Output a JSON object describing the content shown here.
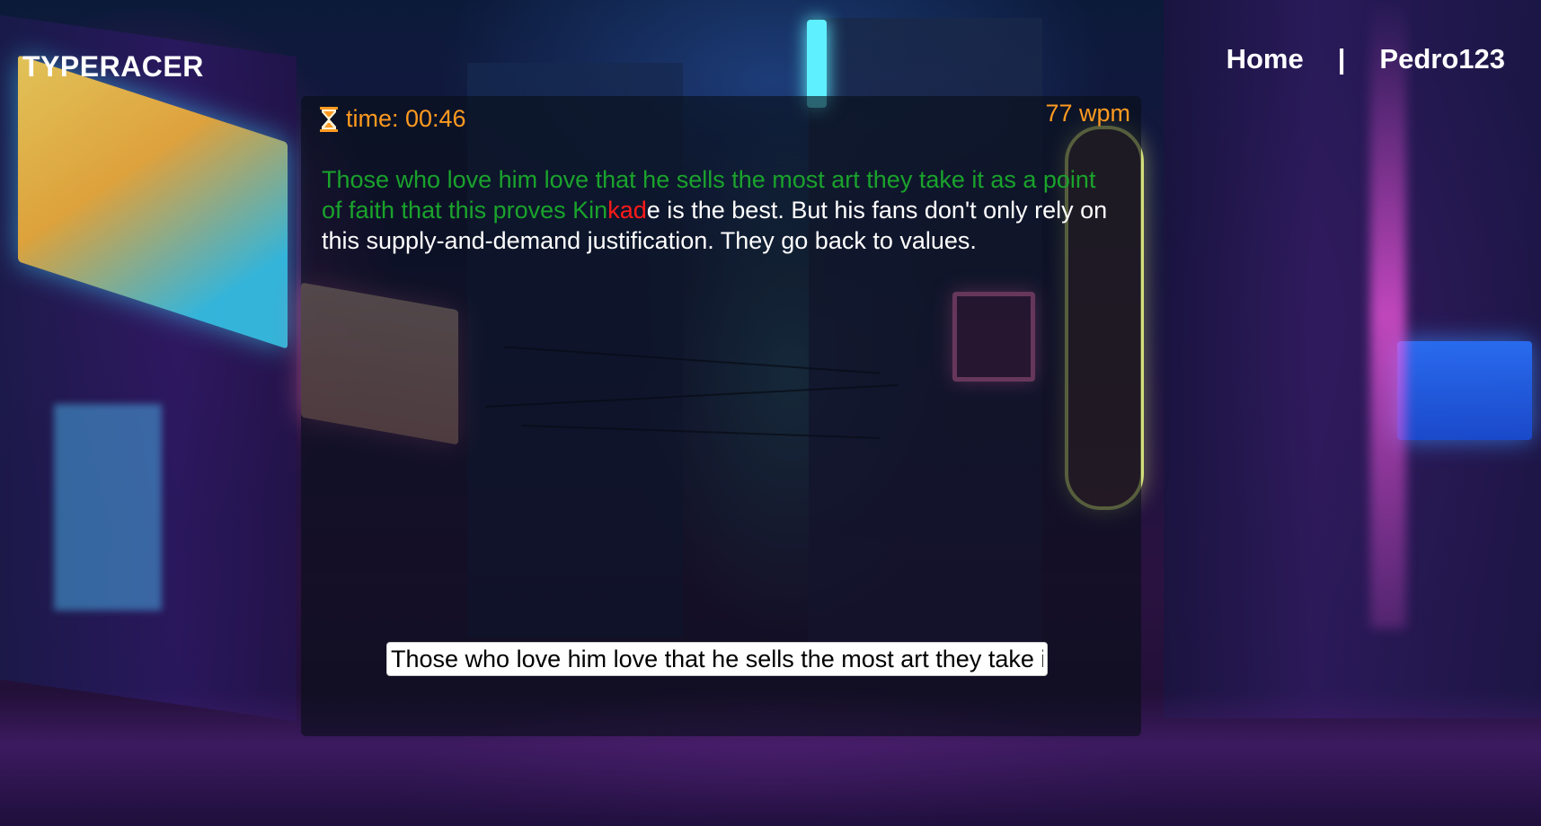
{
  "app": {
    "brand": "TYPERACER"
  },
  "nav": {
    "home_label": "Home",
    "separator": "|",
    "user_label": "Pedro123"
  },
  "race": {
    "timer_icon": "hourglass-icon",
    "timer_text": "time: 00:46",
    "wpm_text": "77 wpm",
    "passage": {
      "typed_correct": "Those who love him love that he sells the most art they take it as a point of faith that this proves Kin",
      "typed_error": "kad",
      "remaining": "e is the best. But his fans don't only rely on this supply-and-demand justification. They go back to values."
    },
    "input_value": "Those who love him love that he sells the most art they take i"
  },
  "colors": {
    "accent_orange": "#ff9a1f",
    "correct_green": "#1aa32c",
    "error_red": "#ff1a1a",
    "text_white": "#ffffff",
    "panel_bg": "rgba(8,14,24,0.62)"
  }
}
